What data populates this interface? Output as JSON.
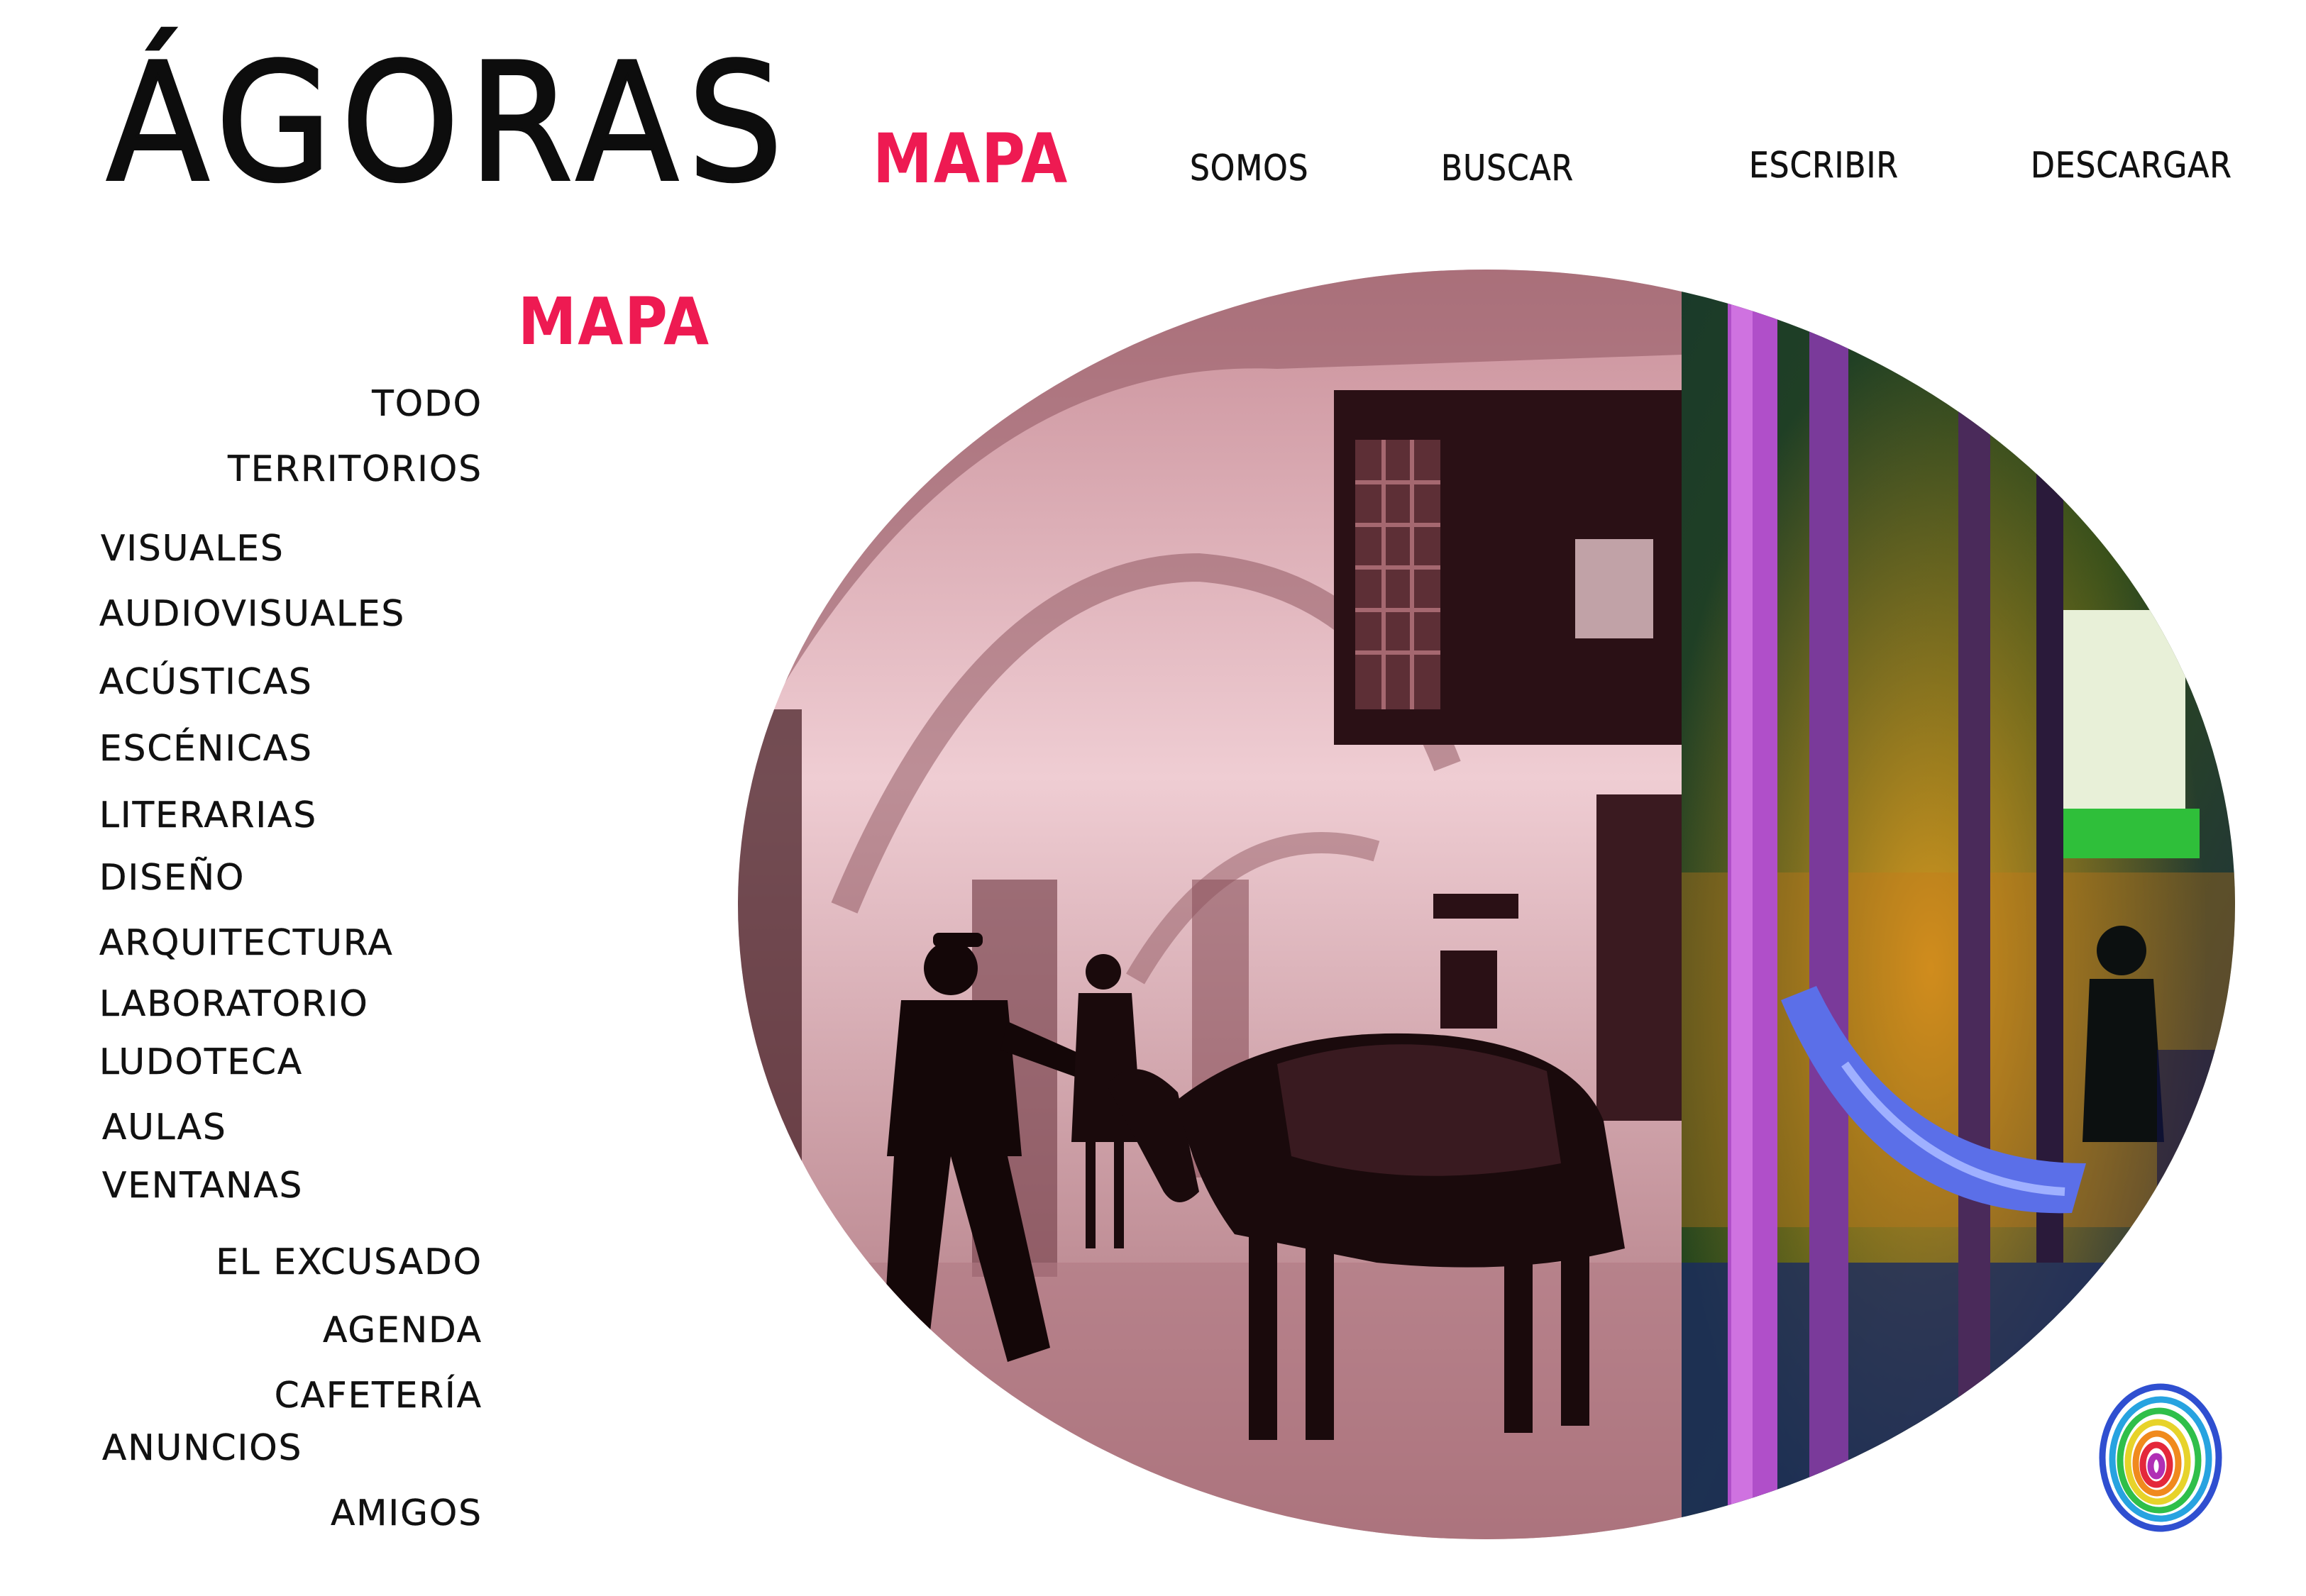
{
  "logo": "ÁGORAS",
  "topnav": [
    {
      "label": "MAPA",
      "active": true
    },
    {
      "label": "SOMOS",
      "active": false
    },
    {
      "label": "BUSCAR",
      "active": false
    },
    {
      "label": "ESCRIBIR",
      "active": false
    },
    {
      "label": "DESCARGAR",
      "active": false
    }
  ],
  "section": {
    "title": "MAPA"
  },
  "sidebar": {
    "top": [
      "TODO",
      "TERRITORIOS"
    ],
    "categories": [
      "VISUALES",
      "AUDIOVISUALES",
      "ACÚSTICAS",
      "ESCÉNICAS",
      "LITERARIAS",
      "DISEÑO",
      "ARQUITECTURA",
      "LABORATORIO",
      "LUDOTECA",
      "AULAS",
      "VENTANAS"
    ],
    "extras": [
      "EL EXCUSADO",
      "AGENDA",
      "CAFETERÍA",
      "ANUNCIOS",
      "AMIGOS"
    ]
  },
  "colors": {
    "accent": "#ee1a52",
    "text": "#111111",
    "sepia_tint": "#d7a3ad"
  },
  "icons": {
    "thumbprint": "rainbow-fingerprint-icon"
  }
}
